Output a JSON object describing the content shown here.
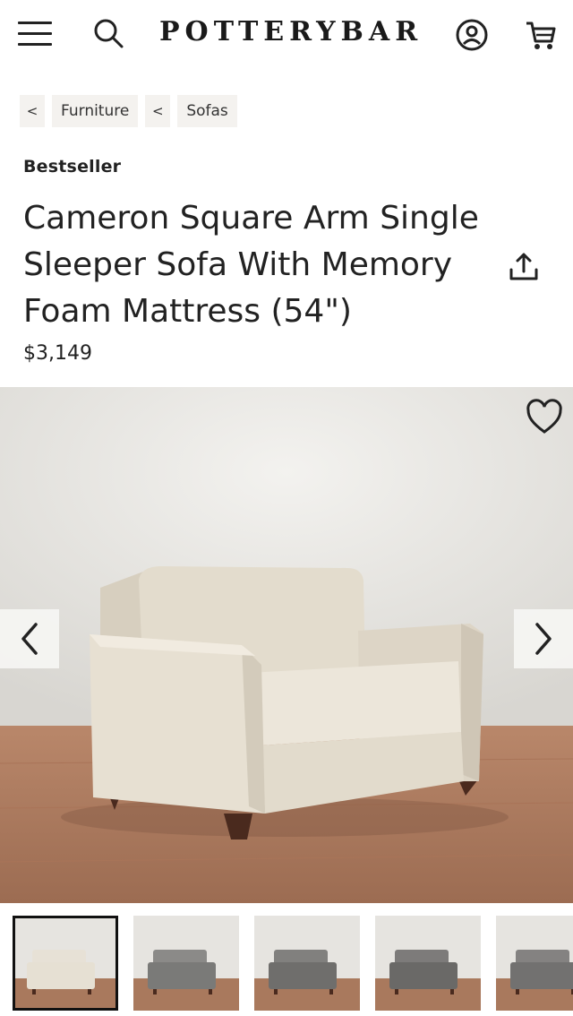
{
  "brand": {
    "logo_text": "POTTERYBARN"
  },
  "header": {
    "menu_icon": "hamburger-menu-icon",
    "search_icon": "search-icon",
    "account_icon": "account-icon",
    "cart_icon": "cart-icon"
  },
  "breadcrumb": [
    {
      "chevron": "<",
      "label": "Furniture"
    },
    {
      "chevron": "<",
      "label": "Sofas"
    }
  ],
  "product": {
    "badge": "Bestseller",
    "title": "Cameron Square Arm Single Sleeper Sofa With Memory Foam Mattress (54\")",
    "price": "$3,149",
    "share_icon": "share-upload-icon",
    "favorite_icon": "heart-icon"
  },
  "gallery": {
    "prev_icon": "chevron-left-icon",
    "next_icon": "chevron-right-icon",
    "thumbnails": [
      {
        "color": "#e6e0d3",
        "selected": true
      },
      {
        "color": "#7a7a78",
        "selected": false
      },
      {
        "color": "#6f6e6c",
        "selected": false
      },
      {
        "color": "#6a6967",
        "selected": false
      },
      {
        "color": "#727170",
        "selected": false
      }
    ]
  },
  "colors": {
    "fabric": "#e4ddcf",
    "wall": "#e9e7e3",
    "floor": "#a7765a",
    "legs": "#4a2a1e"
  }
}
